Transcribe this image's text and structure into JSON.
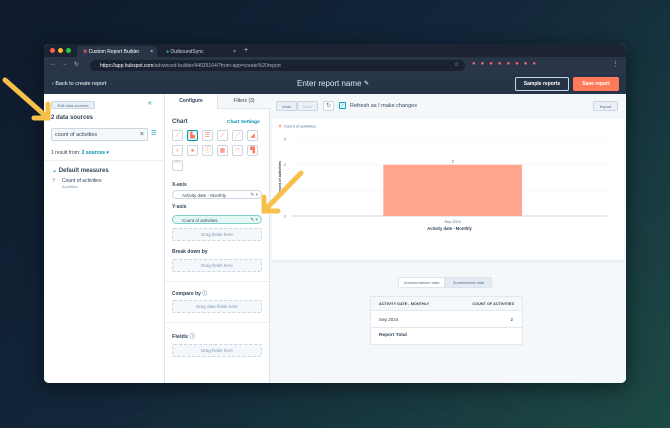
{
  "browser": {
    "tabs": [
      {
        "label": "Custom Report Builder"
      },
      {
        "label": "OutboundSync"
      }
    ],
    "new_tab": "+",
    "url_host": "https://app.hubspot.com",
    "url_path": "/advanced-builder/44025164/?from-app=create%20report"
  },
  "header": {
    "back": "Back to create report",
    "report_name_placeholder": "Enter report name",
    "sample_reports": "Sample reports",
    "save_report": "Save report"
  },
  "left": {
    "edit_sources": "Edit data sources",
    "sources_title": "2 data sources",
    "search_value": "count of activities",
    "result_text": "1 result from:",
    "sources_link": "2 sources",
    "group": "Default measures",
    "item": {
      "label": "Count of activities",
      "sub": "Activities"
    }
  },
  "middle": {
    "tabs": [
      "Configure",
      "Filters (3)"
    ],
    "chart_label": "Chart",
    "chart_settings": "Chart Settings",
    "x_axis": "X-axis",
    "x_field": "Activity date - Monthly",
    "y_axis": "Y-axis",
    "y_field": "Count of activities",
    "drag": "Drag fields here",
    "break_down": "Break down by",
    "compare_by": "Compare by",
    "drag_date": "Drag date fields here",
    "fields": "Fields"
  },
  "toolbar": {
    "undo": "Undo",
    "redo": "Redo",
    "refresh_label": "Refresh as I make changes",
    "export": "Export"
  },
  "chart_data": {
    "type": "bar",
    "categories": [
      "Sep 2024"
    ],
    "values": [
      2
    ],
    "legend": "Count of activities",
    "xlabel": "Activity date - Monthly",
    "ylabel": "Count of activities",
    "ylim": [
      0,
      3
    ],
    "yticks": [
      "0",
      "1",
      "2",
      "3"
    ],
    "color": "#ffa58f"
  },
  "table": {
    "toggle": [
      "Unsummarized data",
      "Summarized data"
    ],
    "headers": [
      "ACTIVITY DATE - MONTHLY",
      "COUNT OF ACTIVITIES"
    ],
    "rows": [
      [
        "Sep 2024",
        "2"
      ]
    ],
    "total_label": "Report Total"
  },
  "colors": {
    "accent": "#ff7a59",
    "link": "#0091ae",
    "header": "#253446"
  }
}
